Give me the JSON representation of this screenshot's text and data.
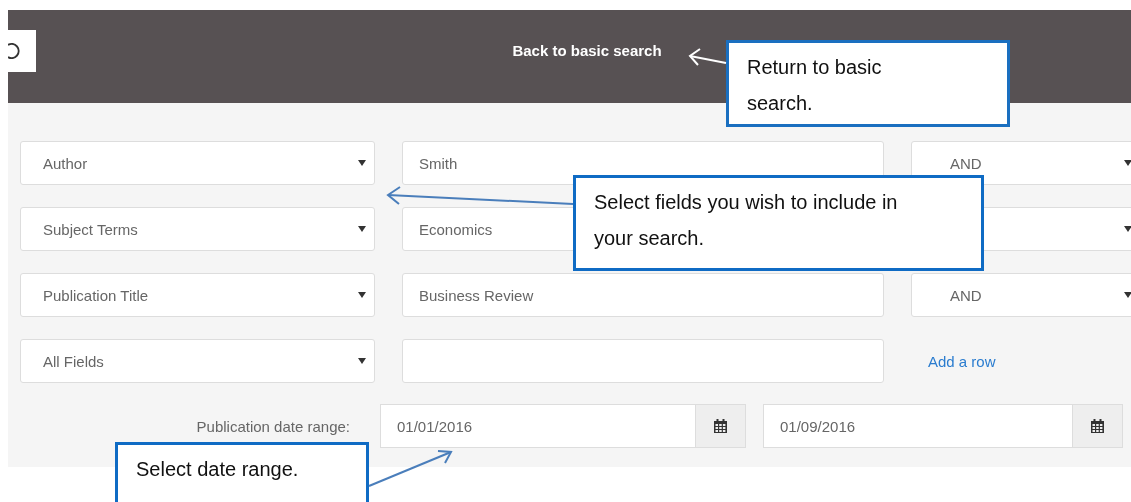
{
  "header": {
    "back_link": "Back to basic search"
  },
  "rows": [
    {
      "field": "Author",
      "term": "Smith",
      "operator": {
        "kind": "select",
        "label": "AND"
      }
    },
    {
      "field": "Subject Terms",
      "term": "Economics",
      "operator": {
        "kind": "select"
      }
    },
    {
      "field": "Publication Title",
      "term": "Business Review",
      "operator": {
        "kind": "select",
        "label": "AND"
      }
    },
    {
      "field": "All Fields",
      "operator": {
        "kind": "link",
        "label": "Add a row"
      }
    }
  ],
  "date_range": {
    "label": "Publication date range:",
    "from": "01/01/2016",
    "to": "01/09/2016"
  },
  "callouts": [
    {
      "text": "Return to basic search.",
      "kind": "light"
    },
    {
      "text": "Select fields you wish to include in your search.",
      "kind": "blue"
    },
    {
      "text": "Select date range.",
      "kind": "blue"
    }
  ]
}
